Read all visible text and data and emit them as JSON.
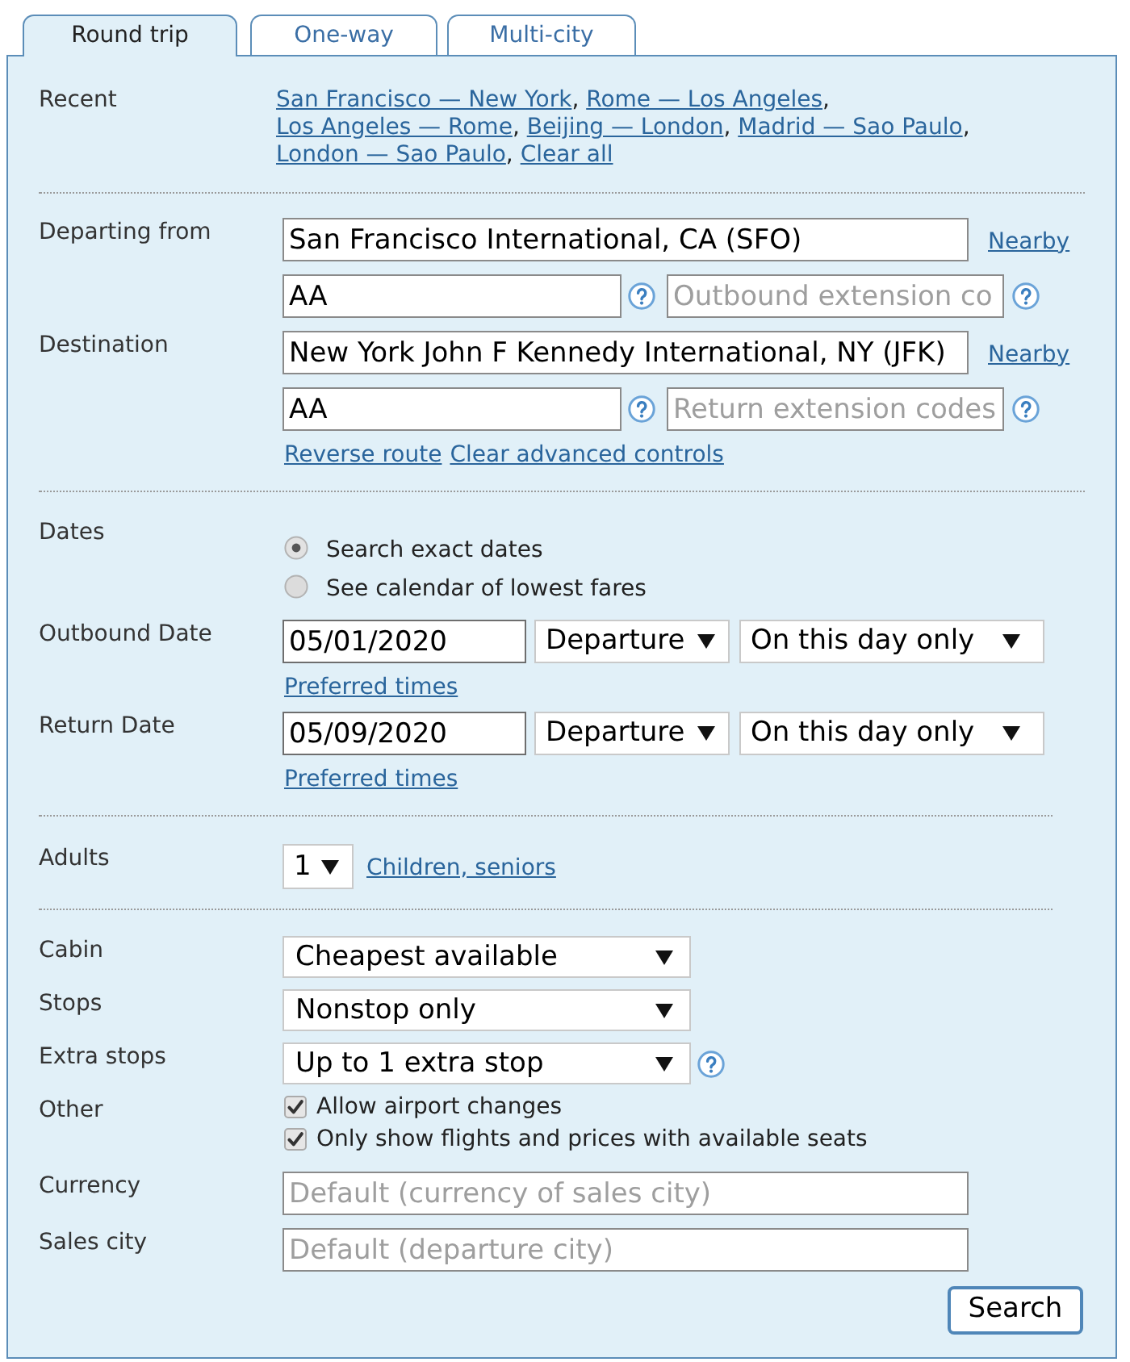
{
  "tabs": [
    {
      "label": "Round trip",
      "selected": true
    },
    {
      "label": "One-way",
      "selected": false
    },
    {
      "label": "Multi-city",
      "selected": false
    }
  ],
  "recent": {
    "label": "Recent",
    "separator": ",",
    "routes": [
      "San Francisco — New York",
      "Rome — Los Angeles",
      "Los Angeles — Rome",
      "Beijing — London",
      "Madrid — Sao Paulo",
      "London — Sao Paulo"
    ],
    "clear_link": "Clear all"
  },
  "route": {
    "legs": [
      {
        "label": "Departing from",
        "airport": "San Francisco International, CA (SFO)",
        "nearby_link": "Nearby",
        "carrier": "AA",
        "extension_placeholder": "Outbound extension co"
      },
      {
        "label": "Destination",
        "airport": "New York John F Kennedy International, NY (JFK)",
        "nearby_link": "Nearby",
        "carrier": "AA",
        "extension_placeholder": "Return extension codes"
      }
    ],
    "links": [
      "Reverse route",
      "Clear advanced controls"
    ]
  },
  "dates": {
    "label": "Dates",
    "modes": [
      {
        "label": "Search exact dates",
        "selected": true
      },
      {
        "label": "See calendar of lowest fares",
        "selected": false
      }
    ],
    "legs": [
      {
        "label": "Outbound Date",
        "date": "05/01/2020",
        "time_type": "Departure",
        "range": "On this day only",
        "times_link": "Preferred times"
      },
      {
        "label": "Return Date",
        "date": "05/09/2020",
        "time_type": "Departure",
        "range": "On this day only",
        "times_link": "Preferred times"
      }
    ]
  },
  "passengers": {
    "label": "Adults",
    "adults": "1",
    "link": "Children, seniors"
  },
  "options": [
    {
      "kind": "select",
      "label": "Cabin",
      "value": "Cheapest available",
      "help": false
    },
    {
      "kind": "select",
      "label": "Stops",
      "value": "Nonstop only",
      "help": false
    },
    {
      "kind": "select",
      "label": "Extra stops",
      "value": "Up to 1 extra stop",
      "help": true
    },
    {
      "kind": "checks",
      "label": "Other",
      "items": [
        {
          "label": "Allow airport changes",
          "checked": true
        },
        {
          "label": "Only show flights and prices with available seats",
          "checked": true
        }
      ]
    },
    {
      "kind": "text",
      "label": "Currency",
      "placeholder": "Default (currency of sales city)"
    },
    {
      "kind": "text",
      "label": "Sales city",
      "placeholder": "Default (departure city)"
    }
  ],
  "search_button": "Search"
}
